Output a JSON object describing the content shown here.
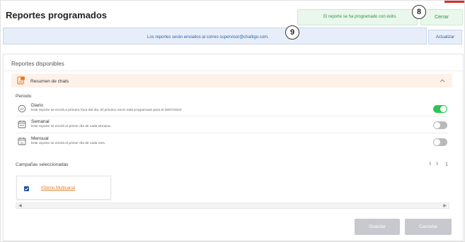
{
  "page": {
    "title": "Reportes programados"
  },
  "annotations": {
    "badge_top": "8",
    "badge_info": "9"
  },
  "toast": {
    "message": "El reporte se ha programado con éxito.",
    "close_label": "Cerrar"
  },
  "info": {
    "text": "Los reportes serán enviados al correo  supervisor@chattigo.com.",
    "refresh_label": "Actualizar"
  },
  "reports": {
    "title": "Reportes disponibles",
    "section_title": "Resumen de chats",
    "period_label": "Periodo",
    "options": [
      {
        "title": "Diario",
        "desc": "Este reporte se envirá a primera hora del día. El próximo envío está programado para el 28/07/2020",
        "icon": "clock-24-icon",
        "enabled": true
      },
      {
        "title": "Semanal",
        "desc": "Este reporte se envirá el primer día de cada semana.",
        "icon": "calendar-week-icon",
        "enabled": false
      },
      {
        "title": "Mensual",
        "desc": "Este reporte se envirá el primer día de cada mes.",
        "icon": "calendar-31-icon",
        "enabled": false
      }
    ],
    "campaigns_label": "Campañas seleccionadas",
    "page_num": "1",
    "campaigns": [
      {
        "name": "#Demo Multicanal",
        "checked": true
      }
    ]
  },
  "actions": {
    "save_label": "Guardar",
    "cancel_label": "Cancelar"
  },
  "colors": {
    "accent_orange": "#e8781f",
    "toggle_on": "#2ec553",
    "toggle_off": "#b9b9b9",
    "info_blue": "#2b5fa8",
    "success_green": "#2f8f46"
  }
}
